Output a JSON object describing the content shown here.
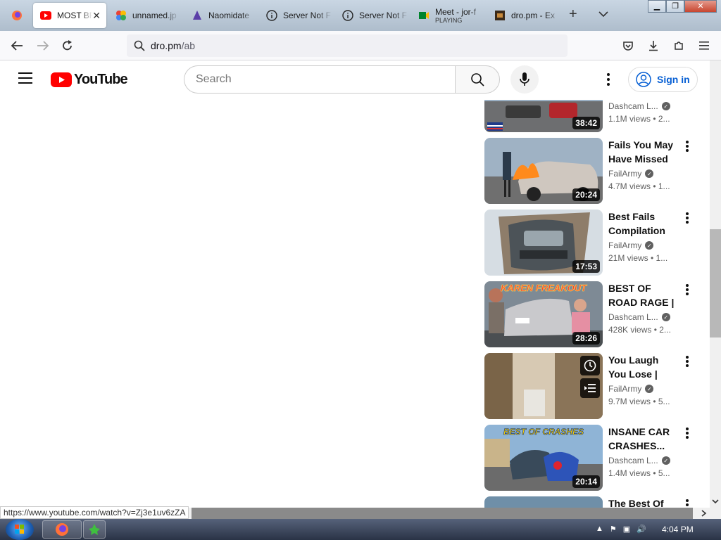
{
  "browser": {
    "tabs": [
      {
        "label": "MOST BR",
        "icon": "youtube-icon",
        "active": true
      },
      {
        "label": "unnamed.jp",
        "icon": "google-photos-icon"
      },
      {
        "label": "Naomidate",
        "icon": "extension-icon"
      },
      {
        "label": "Server Not F",
        "icon": "info-icon"
      },
      {
        "label": "Server Not F",
        "icon": "info-icon"
      },
      {
        "label": "Meet - jor-f",
        "sublabel": "PLAYING",
        "icon": "meet-icon"
      },
      {
        "label": "dro.pm - Ex",
        "icon": "dro-icon"
      }
    ],
    "url": {
      "host": "dro.pm",
      "path": "/ab"
    },
    "status_url": "https://www.youtube.com/watch?v=Zj3e1uv6zZA"
  },
  "youtube": {
    "logo_text": "YouTube",
    "search_placeholder": "Search",
    "sign_in_label": "Sign in"
  },
  "videos": [
    {
      "title": "",
      "channel": "Dashcam L...",
      "meta": "1.1M views  • 2...",
      "duration": "38:42",
      "colors": [
        "#8aa0b6",
        "#6d6e70"
      ]
    },
    {
      "title": "Fails You May Have Missed |...",
      "channel": "FailArmy",
      "meta": "4.7M views  • 1...",
      "duration": "20:24",
      "colors": [
        "#9fb2c4",
        "#cfc7bf"
      ]
    },
    {
      "title": "Best Fails Compilation 😂",
      "channel": "FailArmy",
      "meta": "21M views  • 1...",
      "duration": "17:53",
      "colors": [
        "#c8d3dc",
        "#4c5358"
      ]
    },
    {
      "title": "BEST OF ROAD RAGE | USA &...",
      "channel": "Dashcam L...",
      "meta": "428K views  • 2...",
      "duration": "28:26",
      "caption": "KAREN FREAKOUT",
      "colors": [
        "#7e8a95",
        "#c9c9cc"
      ]
    },
    {
      "title": "You Laugh You Lose | Dumb...",
      "channel": "FailArmy",
      "meta": "9.7M views  • 5...",
      "duration": "",
      "colors": [
        "#a08c6e",
        "#d7c9b3"
      ]
    },
    {
      "title": "INSANE CAR CRASHES...",
      "channel": "Dashcam L...",
      "meta": "1.4M views  • 5...",
      "duration": "20:14",
      "caption": "BEST OF CRASHES",
      "colors": [
        "#8fb4d6",
        "#5b6c7a"
      ]
    },
    {
      "title": "The Best Of",
      "channel": "",
      "meta": "",
      "duration": "",
      "colors": [
        "#6f8fa8",
        "#3e5366"
      ]
    }
  ],
  "taskbar": {
    "clock": "4:04 PM"
  }
}
